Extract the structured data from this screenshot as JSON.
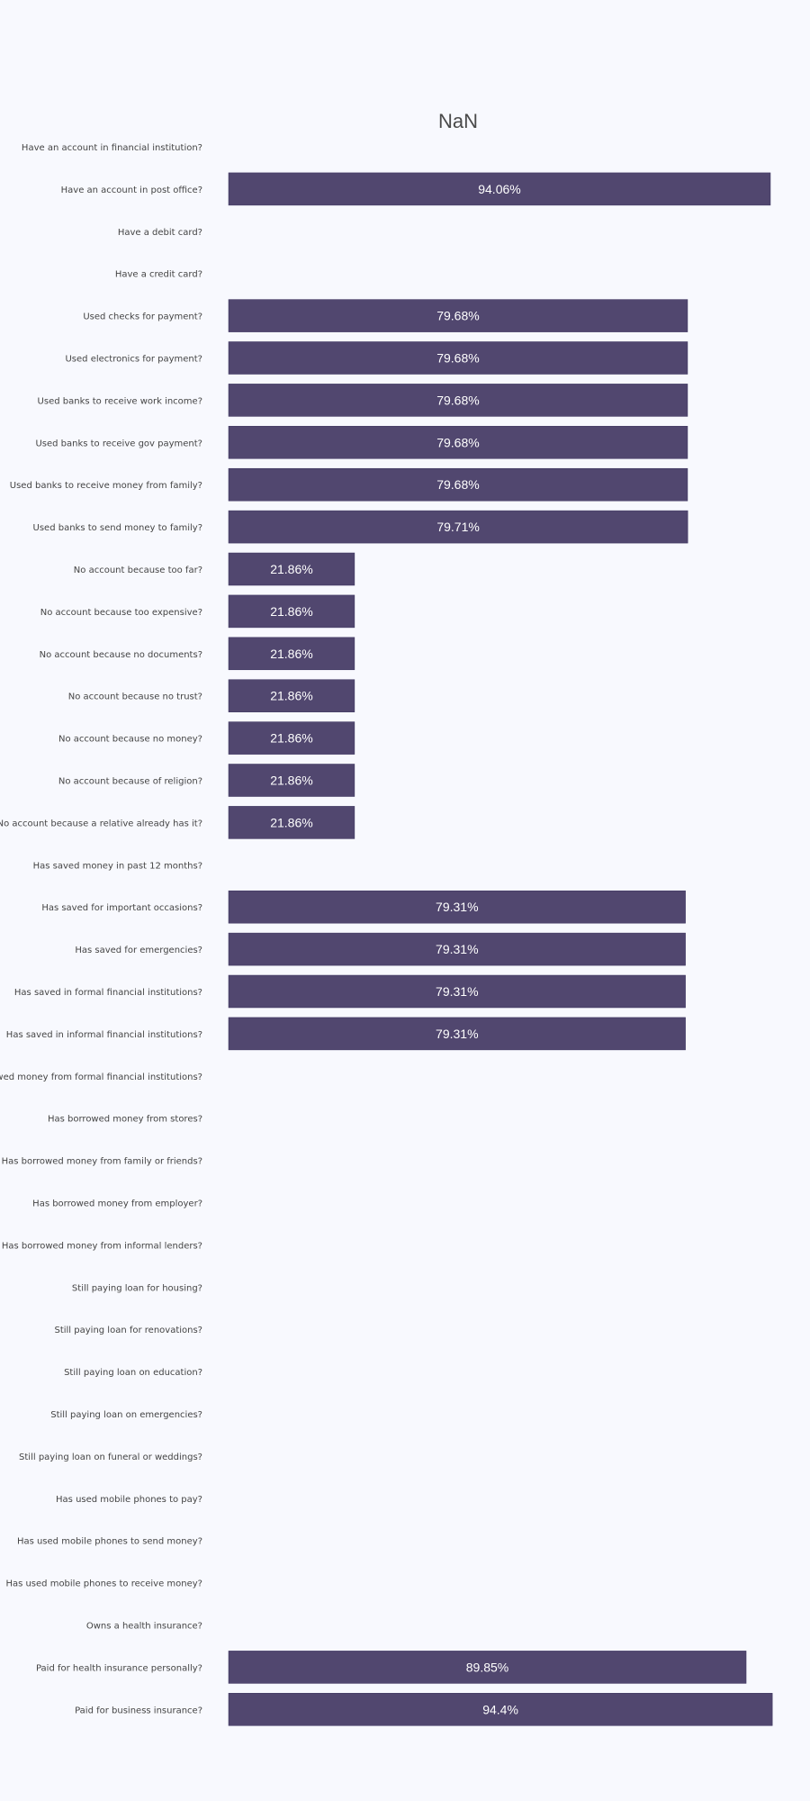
{
  "chart_data": {
    "type": "bar",
    "orientation": "horizontal",
    "title": "NaN",
    "xlabel": "",
    "ylabel": "",
    "xlim": [
      0,
      100
    ],
    "grid": false,
    "categories": [
      "Have an account in financial institution?",
      "Have an account in post office?",
      "Have a debit card?",
      "Have a credit card?",
      "Used checks for payment?",
      "Used electronics for payment?",
      "Used banks to receive work income?",
      "Used banks to receive gov payment?",
      "Used banks to receive money from family?",
      "Used banks to send money to family?",
      "No account because too far?",
      "No account because too expensive?",
      "No account because no documents?",
      "No account because no trust?",
      "No account because no money?",
      "No account because of religion?",
      "No account because a relative already has it?",
      "Has saved money in past 12 months?",
      "Has saved for important occasions?",
      "Has saved for emergencies?",
      "Has saved in formal financial institutions?",
      "Has saved in informal financial institutions?",
      "Has borrowed money from formal financial institutions?",
      "Has borrowed money from stores?",
      "Has borrowed money from family or friends?",
      "Has borrowed money from employer?",
      "Has borrowed money from informal lenders?",
      "Still paying loan for housing?",
      "Still paying loan for renovations?",
      "Still paying loan on education?",
      "Still paying loan on emergencies?",
      "Still paying loan on funeral or weddings?",
      "Has used mobile phones to pay?",
      "Has used mobile phones to send money?",
      "Has used mobile phones to receive money?",
      "Owns a health insurance?",
      "Paid for health insurance personally?",
      "Paid for business insurance?"
    ],
    "values": [
      null,
      94.06,
      null,
      null,
      79.68,
      79.68,
      79.68,
      79.68,
      79.68,
      79.71,
      21.86,
      21.86,
      21.86,
      21.86,
      21.86,
      21.86,
      21.86,
      null,
      79.31,
      79.31,
      79.31,
      79.31,
      null,
      null,
      null,
      null,
      null,
      null,
      null,
      null,
      null,
      null,
      null,
      null,
      null,
      null,
      89.85,
      94.4
    ],
    "value_labels": [
      "",
      "94.06%",
      "",
      "",
      "79.68%",
      "79.68%",
      "79.68%",
      "79.68%",
      "79.68%",
      "79.71%",
      "21.86%",
      "21.86%",
      "21.86%",
      "21.86%",
      "21.86%",
      "21.86%",
      "21.86%",
      "",
      "79.31%",
      "79.31%",
      "79.31%",
      "79.31%",
      "",
      "",
      "",
      "",
      "",
      "",
      "",
      "",
      "",
      "",
      "",
      "",
      "",
      "",
      "89.85%",
      "94.4%"
    ],
    "colors": {
      "bar": "#51476f",
      "background": "#f8f9fe"
    }
  }
}
